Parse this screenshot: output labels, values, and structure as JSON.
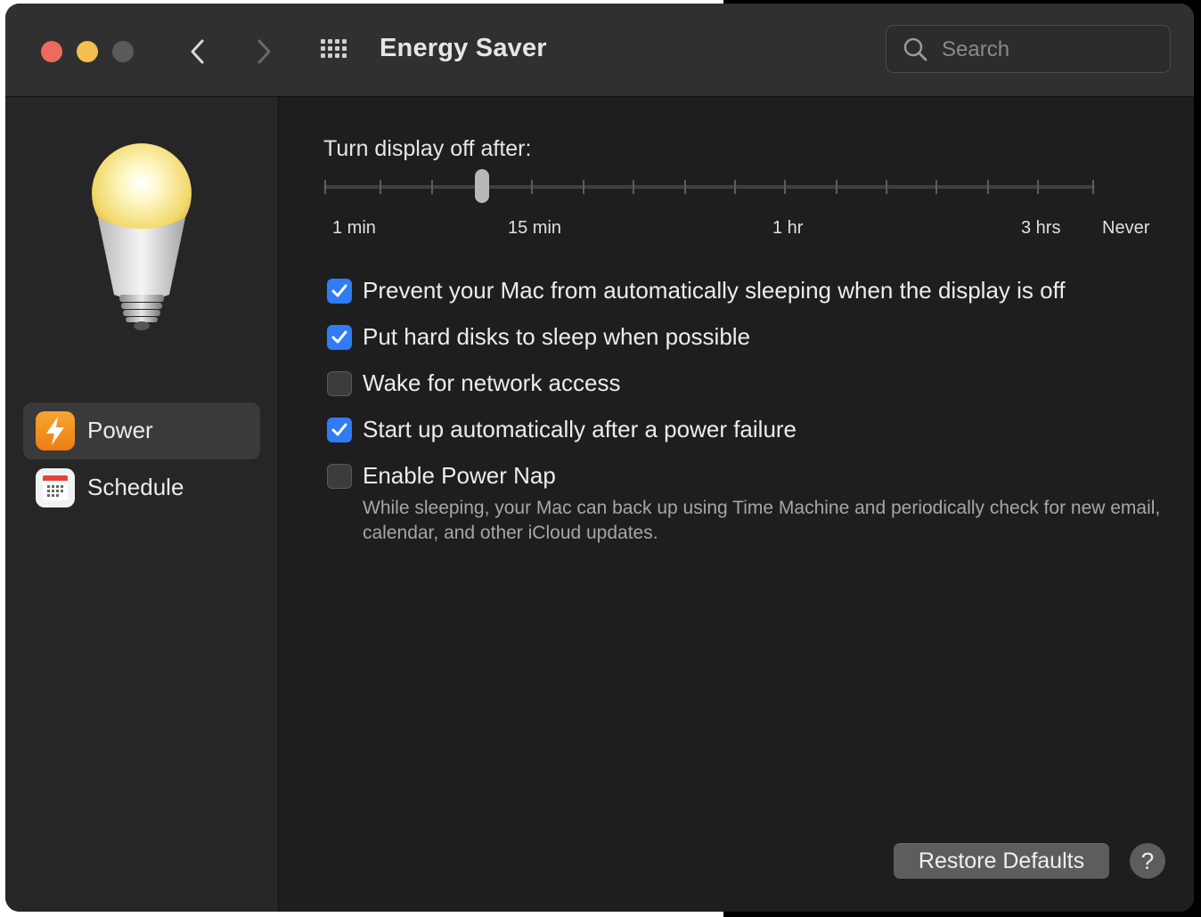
{
  "window": {
    "title": "Energy Saver",
    "search_placeholder": "Search"
  },
  "sidebar": {
    "items": [
      {
        "label": "Power",
        "icon": "power-bolt-icon",
        "active": true
      },
      {
        "label": "Schedule",
        "icon": "calendar-icon",
        "active": false
      }
    ]
  },
  "display_sleep": {
    "label": "Turn display off after:",
    "tick_labels": [
      "1 min",
      "15 min",
      "1 hr",
      "3 hrs",
      "Never"
    ],
    "current_value": "10 min"
  },
  "options": [
    {
      "label": "Prevent your Mac from automatically sleeping when the display is off",
      "checked": true
    },
    {
      "label": "Put hard disks to sleep when possible",
      "checked": true
    },
    {
      "label": "Wake for network access",
      "checked": false
    },
    {
      "label": "Start up automatically after a power failure",
      "checked": true
    },
    {
      "label": "Enable Power Nap",
      "checked": false
    }
  ],
  "power_nap_description": "While sleeping, your Mac can back up using Time Machine and periodically check for new email, calendar, and other iCloud updates.",
  "buttons": {
    "restore_defaults": "Restore Defaults",
    "help": "?"
  },
  "colors": {
    "accent": "#2f7cf6",
    "window_bg": "#1e1e1e",
    "close": "#ed6a5e",
    "minimize": "#f5bf4f"
  }
}
